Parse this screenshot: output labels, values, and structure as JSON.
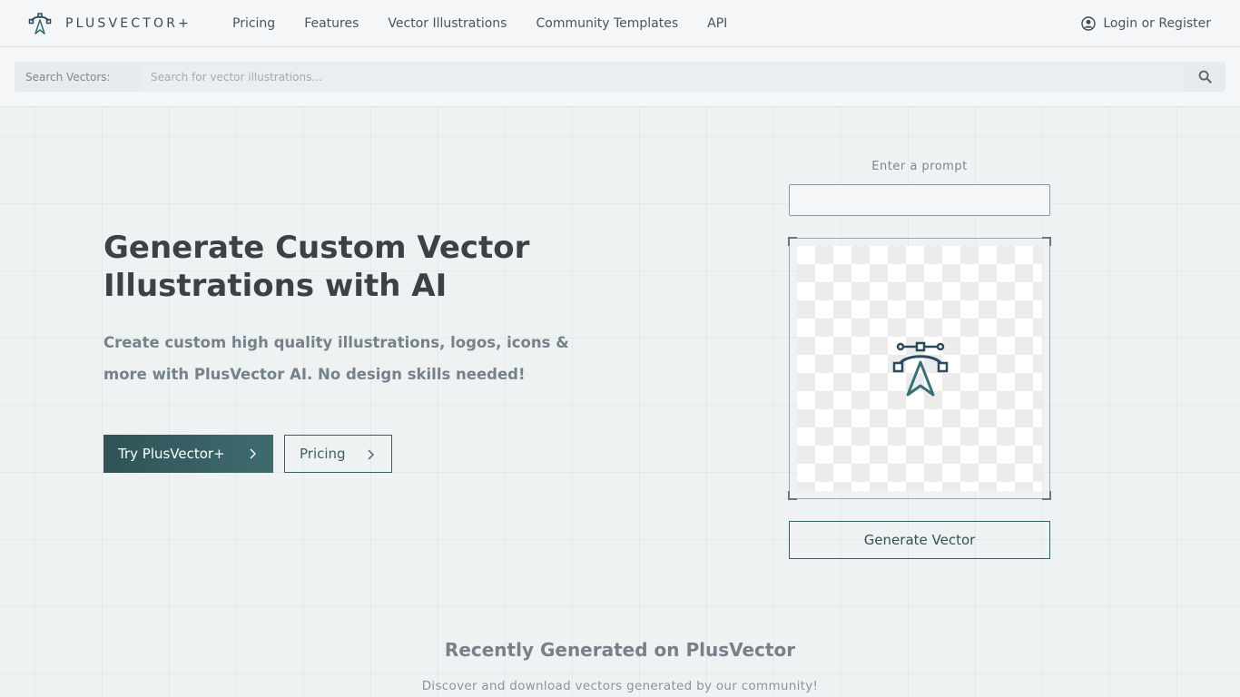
{
  "header": {
    "brand": "PLUSVECTOR+",
    "nav": [
      "Pricing",
      "Features",
      "Vector Illustrations",
      "Community Templates",
      "API"
    ],
    "login": "Login or Register"
  },
  "search": {
    "label": "Search Vectors:",
    "placeholder": "Search for vector illustrations..."
  },
  "hero": {
    "title": "Generate Custom Vector Illustrations with AI",
    "subtitle": "Create custom high quality illustrations, logos, icons & more with PlusVector AI. No design skills needed!",
    "primary_button": "Try PlusVector+",
    "secondary_button": "Pricing"
  },
  "prompt": {
    "label": "Enter a prompt",
    "value": "",
    "generate_button": "Generate Vector"
  },
  "recent": {
    "title": "Recently Generated on PlusVector",
    "subtitle": "Discover and download vectors generated by our community!"
  },
  "colors": {
    "accent": "#2f5357",
    "icon_dark": "#2c4a5e",
    "icon_teal": "#3a6f73"
  },
  "icons": [
    "plusvector-logo-icon",
    "user-circle-icon",
    "search-icon",
    "chevron-right-icon",
    "bezier-pen-icon"
  ]
}
